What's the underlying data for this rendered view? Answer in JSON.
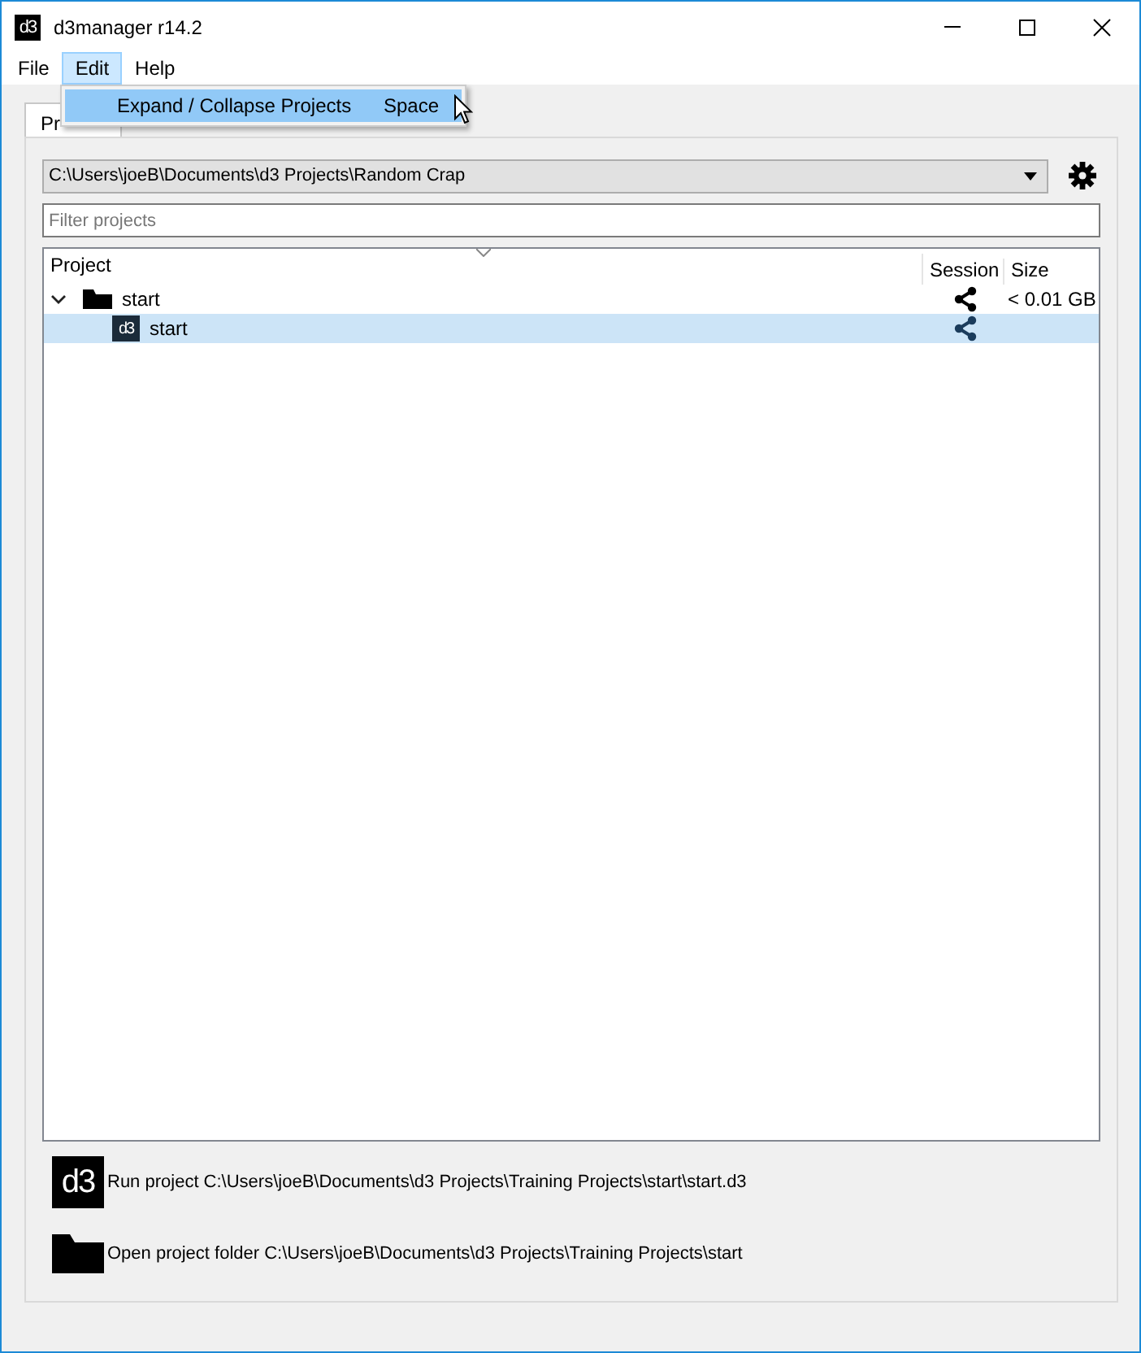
{
  "window": {
    "logo": "d3",
    "title": "d3manager  r14.2"
  },
  "menu_bar": [
    {
      "label": "File",
      "selected": false
    },
    {
      "label": "Edit",
      "selected": true
    },
    {
      "label": "Help",
      "selected": false
    }
  ],
  "open_menu": {
    "items": [
      {
        "label": "Expand / Collapse Projects",
        "shortcut": "Space",
        "selected": true
      }
    ]
  },
  "tabs": [
    {
      "label": "Pr",
      "selected": true
    }
  ],
  "path_combo": {
    "value": "C:\\Users\\joeB\\Documents\\d3 Projects\\Random Crap"
  },
  "filter": {
    "placeholder": "Filter projects"
  },
  "tree": {
    "columns": [
      "Project",
      "Session",
      "Size"
    ],
    "rows": [
      {
        "kind": "folder",
        "name": "start",
        "expanded": true,
        "selected": false,
        "size": "< 0.01 GB",
        "children": [
          {
            "kind": "project",
            "icon": "d3",
            "name": "start",
            "selected": true
          }
        ]
      }
    ]
  },
  "actions": [
    {
      "kind": "run",
      "icon": "d3",
      "label": "Run project C:\\Users\\joeB\\Documents\\d3 Projects\\Training Projects\\start\\start.d3"
    },
    {
      "kind": "folder",
      "label": "Open project folder C:\\Users\\joeB\\Documents\\d3 Projects\\Training Projects\\start"
    }
  ]
}
